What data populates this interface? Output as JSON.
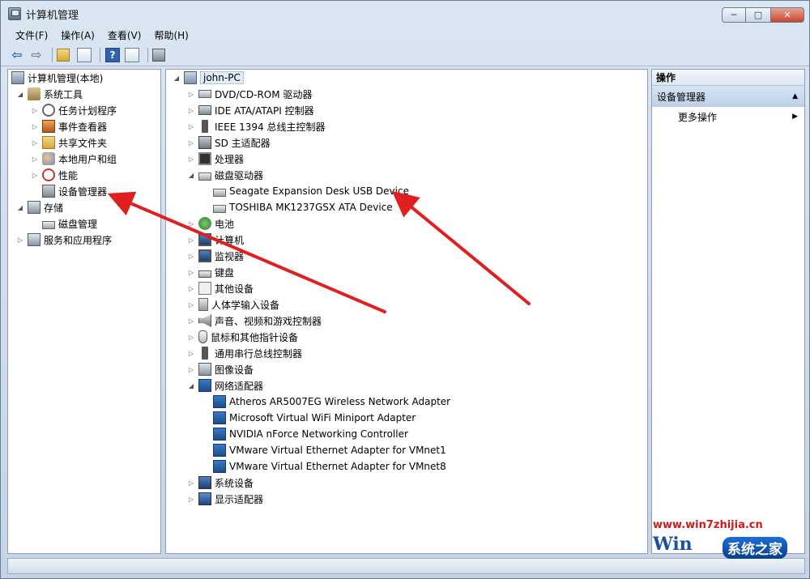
{
  "window": {
    "title": "计算机管理",
    "controls": {
      "minimize": "─",
      "maximize": "□",
      "close": "✕"
    }
  },
  "menu": [
    "文件(F)",
    "操作(A)",
    "查看(V)",
    "帮助(H)"
  ],
  "toolbar": {
    "icons": [
      "back-arrow-icon",
      "forward-arrow-icon",
      "up-folder-icon",
      "show-hide-tree-icon",
      "help-icon",
      "show-hide-action-icon",
      "device-scan-icon"
    ]
  },
  "left_tree": {
    "root": "计算机管理(本地)",
    "items": [
      {
        "label": "系统工具",
        "level": 1,
        "expanded": true
      },
      {
        "label": "任务计划程序",
        "level": 2,
        "expanded": false
      },
      {
        "label": "事件查看器",
        "level": 2,
        "expanded": false
      },
      {
        "label": "共享文件夹",
        "level": 2,
        "expanded": false
      },
      {
        "label": "本地用户和组",
        "level": 2,
        "expanded": false
      },
      {
        "label": "性能",
        "level": 2,
        "expanded": false
      },
      {
        "label": "设备管理器",
        "level": 2,
        "expanded": null
      },
      {
        "label": "存储",
        "level": 1,
        "expanded": true
      },
      {
        "label": "磁盘管理",
        "level": 2,
        "expanded": null
      },
      {
        "label": "服务和应用程序",
        "level": 1,
        "expanded": false
      }
    ]
  },
  "device_tree": {
    "root": "john-PC",
    "items": [
      {
        "label": "DVD/CD-ROM 驱动器",
        "level": 1,
        "expanded": false
      },
      {
        "label": "IDE ATA/ATAPI 控制器",
        "level": 1,
        "expanded": false
      },
      {
        "label": "IEEE 1394 总线主控制器",
        "level": 1,
        "expanded": false
      },
      {
        "label": "SD 主适配器",
        "level": 1,
        "expanded": false
      },
      {
        "label": "处理器",
        "level": 1,
        "expanded": false
      },
      {
        "label": "磁盘驱动器",
        "level": 1,
        "expanded": true
      },
      {
        "label": "Seagate Expansion Desk USB Device",
        "level": 2,
        "expanded": null
      },
      {
        "label": "TOSHIBA MK1237GSX ATA Device",
        "level": 2,
        "expanded": null
      },
      {
        "label": "电池",
        "level": 1,
        "expanded": false
      },
      {
        "label": "计算机",
        "level": 1,
        "expanded": false
      },
      {
        "label": "监视器",
        "level": 1,
        "expanded": false
      },
      {
        "label": "键盘",
        "level": 1,
        "expanded": false
      },
      {
        "label": "其他设备",
        "level": 1,
        "expanded": false
      },
      {
        "label": "人体学输入设备",
        "level": 1,
        "expanded": false
      },
      {
        "label": "声音、视频和游戏控制器",
        "level": 1,
        "expanded": false
      },
      {
        "label": "鼠标和其他指针设备",
        "level": 1,
        "expanded": false
      },
      {
        "label": "通用串行总线控制器",
        "level": 1,
        "expanded": false
      },
      {
        "label": "图像设备",
        "level": 1,
        "expanded": false
      },
      {
        "label": "网络适配器",
        "level": 1,
        "expanded": true
      },
      {
        "label": "Atheros AR5007EG Wireless Network Adapter",
        "level": 2,
        "expanded": null
      },
      {
        "label": "Microsoft Virtual WiFi Miniport Adapter",
        "level": 2,
        "expanded": null
      },
      {
        "label": "NVIDIA nForce Networking Controller",
        "level": 2,
        "expanded": null
      },
      {
        "label": "VMware Virtual Ethernet Adapter for VMnet1",
        "level": 2,
        "expanded": null
      },
      {
        "label": "VMware Virtual Ethernet Adapter for VMnet8",
        "level": 2,
        "expanded": null
      },
      {
        "label": "系统设备",
        "level": 1,
        "expanded": false
      },
      {
        "label": "显示适配器",
        "level": 1,
        "expanded": false
      }
    ]
  },
  "actions": {
    "header": "操作",
    "section": "设备管理器",
    "more": "更多操作"
  },
  "watermark": {
    "url": "www.win7zhijia.cn",
    "logo": "系统之家",
    "win": "Win"
  },
  "colors": {
    "arrow": "#e02020",
    "accent": "#2f63ad"
  }
}
